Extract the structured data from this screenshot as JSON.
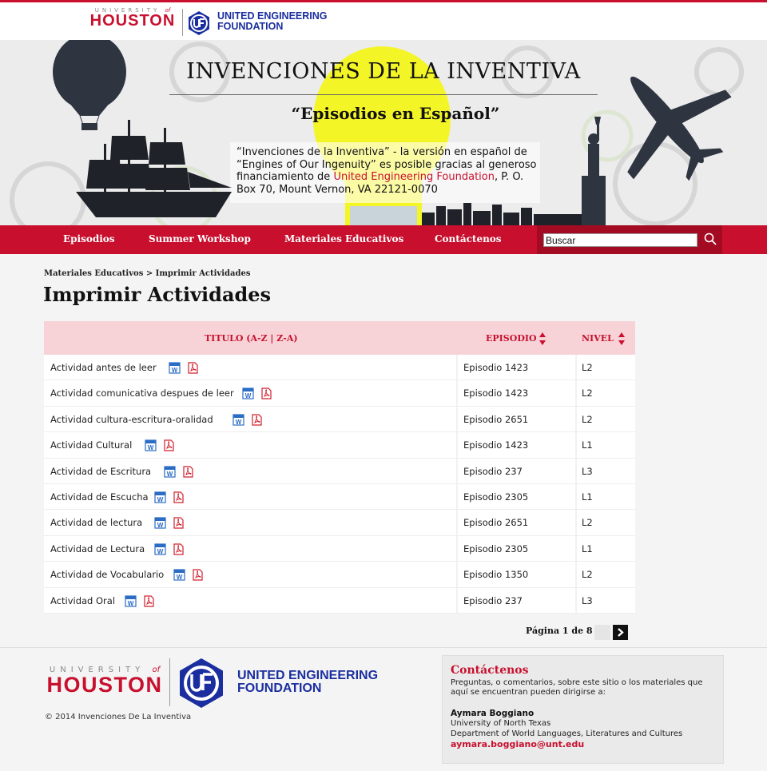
{
  "header": {
    "uh_small": "UNIVERSITY",
    "uh_of": "of",
    "uh_big": "HOUSTON",
    "uef_line1": "UNITED ENGINEERING",
    "uef_line2": "FOUNDATION"
  },
  "hero": {
    "title": "INVENCIONES DE LA INVENTIVA",
    "subtitle": "“Episodios en Español”",
    "desc_1": "“Invenciones de la Inventiva” - la versión en español de “Engines of Our Ingenuity” es posible gracias al generoso financiamiento de ",
    "desc_link": "United Engineering Foundation",
    "desc_2": ", P. O. Box 70, Mount Vernon, VA 22121-0070"
  },
  "nav": {
    "items": [
      "Episodios",
      "Summer Workshop",
      "Materiales Educativos",
      "Contáctenos"
    ],
    "search_value": "Buscar"
  },
  "breadcrumb": "Materiales Educativos > Imprimir Actividades",
  "page_title": "Imprimir Actividades",
  "table": {
    "headers": {
      "titulo": "TITULO (A-Z | Z-A)",
      "episodio": "EPISODIO",
      "nivel": "NIVEL"
    },
    "rows": [
      {
        "title": "Actividad antes de leer",
        "episode": "Episodio 1423",
        "level": "L2"
      },
      {
        "title": "Actividad comunicativa despues de leer",
        "episode": "Episodio 1423",
        "level": "L2"
      },
      {
        "title": "Actividad cultura-escritura-oralidad",
        "episode": "Episodio 2651",
        "level": "L2"
      },
      {
        "title": "Actividad Cultural",
        "episode": "Episodio 1423",
        "level": "L1"
      },
      {
        "title": "Actividad de Escritura",
        "episode": "Episodio 237",
        "level": "L3"
      },
      {
        "title": "Actividad de Escucha",
        "episode": "Episodio 2305",
        "level": "L1"
      },
      {
        "title": "Actividad de lectura",
        "episode": "Episodio 2651",
        "level": "L2"
      },
      {
        "title": "Actividad de Lectura",
        "episode": "Episodio 2305",
        "level": "L1"
      },
      {
        "title": "Actividad de Vocabulario",
        "episode": "Episodio 1350",
        "level": "L2"
      },
      {
        "title": "Actividad Oral",
        "episode": "Episodio 237",
        "level": "L3"
      }
    ]
  },
  "pager": {
    "label": "Página 1 de 8"
  },
  "footer": {
    "uh_small": "UNIVERSITY",
    "uh_of": "of",
    "uh_big": "HOUSTON",
    "uef_line1": "UNITED ENGINEERING",
    "uef_line2": "FOUNDATION",
    "copyright": "© 2014 Invenciones De La Inventiva",
    "contact_title": "Contáctenos",
    "contact_text": "Preguntas, o comentarios, sobre este sitio o los materiales que aquí se encuentran pueden dirigirse a:",
    "contact_name": "Aymara Boggiano",
    "contact_line1": "University of North Texas",
    "contact_line2": "Department of World Languages, Literatures and Cultures",
    "contact_email": "aymara.boggiano@unt.edu"
  },
  "colors": {
    "brand_red": "#c8102e",
    "uef_blue": "#1a2e9f",
    "header_pink": "#f7d3d8"
  },
  "icons": [
    "word-doc-icon",
    "pdf-icon",
    "search-icon",
    "sort-arrows-icon",
    "chevron-right-icon"
  ]
}
